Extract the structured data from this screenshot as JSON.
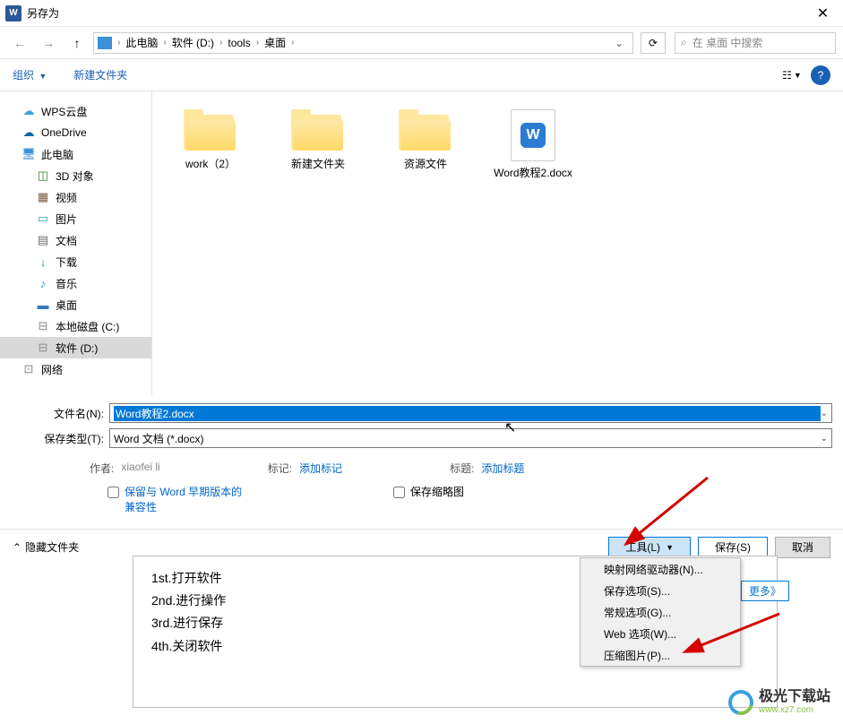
{
  "title": "另存为",
  "breadcrumb": [
    "此电脑",
    "软件 (D:)",
    "tools",
    "桌面"
  ],
  "search_placeholder": "在 桌面 中搜索",
  "toolbar": {
    "organize": "组织",
    "newfolder": "新建文件夹"
  },
  "sidebar": [
    {
      "label": "WPS云盘",
      "icon": "☁",
      "color": "#3aa0e0"
    },
    {
      "label": "OneDrive",
      "icon": "☁",
      "color": "#0a64a4"
    },
    {
      "label": "此电脑",
      "icon": "🖥",
      "color": "#3b90d8"
    },
    {
      "label": "3D 对象",
      "icon": "◫",
      "color": "#2e7d32",
      "sub": true
    },
    {
      "label": "视频",
      "icon": "▦",
      "color": "#7b5c42",
      "sub": true
    },
    {
      "label": "图片",
      "icon": "▭",
      "color": "#2aa3c9",
      "sub": true
    },
    {
      "label": "文档",
      "icon": "▤",
      "color": "#6b6b6b",
      "sub": true
    },
    {
      "label": "下载",
      "icon": "↓",
      "color": "#2aa34a",
      "sub": true
    },
    {
      "label": "音乐",
      "icon": "♪",
      "color": "#1a9ad6",
      "sub": true
    },
    {
      "label": "桌面",
      "icon": "▬",
      "color": "#2f7ab8",
      "sub": true
    },
    {
      "label": "本地磁盘 (C:)",
      "icon": "⊟",
      "color": "#888",
      "sub": true
    },
    {
      "label": "软件 (D:)",
      "icon": "⊟",
      "color": "#888",
      "sub": true,
      "selected": true
    },
    {
      "label": "网络",
      "icon": "⊡",
      "color": "#888"
    }
  ],
  "files": [
    {
      "name": "work（2）",
      "type": "folder"
    },
    {
      "name": "新建文件夹",
      "type": "folder"
    },
    {
      "name": "资源文件",
      "type": "folder-media"
    },
    {
      "name": "Word教程2.docx",
      "type": "word"
    }
  ],
  "filename_label": "文件名(N):",
  "filetype_label": "保存类型(T):",
  "filename_value": "Word教程2.docx",
  "filetype_value": "Word 文档 (*.docx)",
  "meta": {
    "author_lbl": "作者:",
    "author_val": "xiaofei li",
    "tag_lbl": "标记:",
    "tag_val": "添加标记",
    "title_lbl": "标题:",
    "title_val": "添加标题"
  },
  "checks": {
    "compat": "保留与 Word 早期版本的兼容性",
    "thumb": "保存缩略图"
  },
  "footer": {
    "hide": "隐藏文件夹",
    "tools": "工具(L)",
    "save": "保存(S)",
    "cancel": "取消"
  },
  "tools_menu": [
    "映射网络驱动器(N)...",
    "保存选项(S)...",
    "常规选项(G)...",
    "Web 选项(W)...",
    "压缩图片(P)..."
  ],
  "doc_lines": [
    "1st.打开软件",
    "2nd.进行操作",
    "3rd.进行保存",
    "4th.关闭软件"
  ],
  "more": "更多》",
  "brand": {
    "name": "极光下载站",
    "url": "www.xz7.com"
  }
}
